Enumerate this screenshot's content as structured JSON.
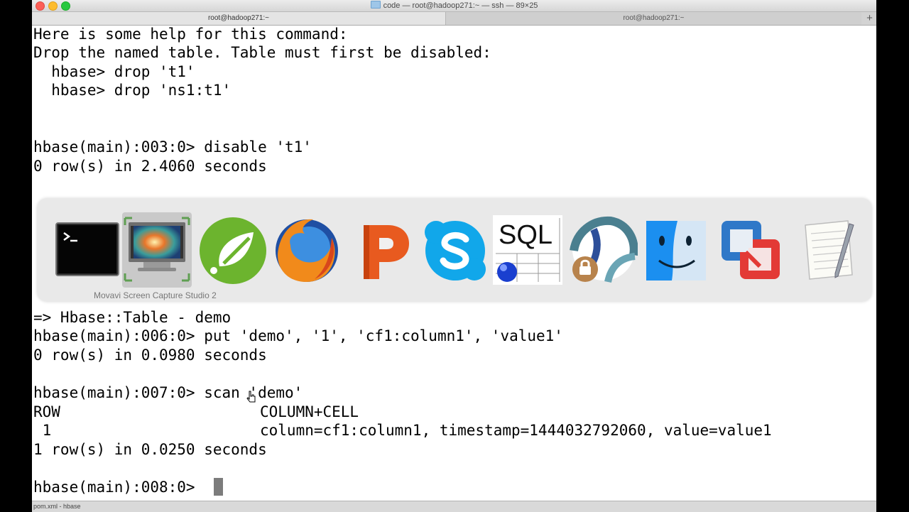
{
  "window": {
    "title": "code — root@hadoop271:~ — ssh — 89×25",
    "tabs": [
      {
        "label": "root@hadoop271:~"
      },
      {
        "label": "root@hadoop271:~"
      }
    ],
    "add_tab": "+"
  },
  "terminal": {
    "lines": [
      "Here is some help for this command:",
      "Drop the named table. Table must first be disabled:",
      "  hbase> drop 't1'",
      "  hbase> drop 'ns1:t1'",
      "hbase(main):003:0> disable 't1'",
      "0 row(s) in 2.4060 seconds",
      "=> Hbase::Table - demo",
      "hbase(main):006:0> put 'demo', '1', 'cf1:column1', 'value1'",
      "0 row(s) in 0.0980 seconds",
      "hbase(main):007:0> scan 'demo'",
      "1 row(s) in 0.0250 seconds",
      "hbase(main):008:0> "
    ],
    "scan_header": {
      "left": "ROW",
      "right": "COLUMN+CELL"
    },
    "scan_row": {
      "left": " 1",
      "right": "column=cf1:column1, timestamp=1444032792060, value=value1"
    }
  },
  "dock": {
    "tooltip": "Movavi Screen Capture Studio 2",
    "apps": [
      {
        "icon": "terminal-icon"
      },
      {
        "icon": "movavi-screen-capture-icon"
      },
      {
        "icon": "spring-icon"
      },
      {
        "icon": "firefox-icon"
      },
      {
        "icon": "wps-presentation-icon"
      },
      {
        "icon": "skype-icon"
      },
      {
        "icon": "sql-developer-icon",
        "label": "SQL"
      },
      {
        "icon": "vpn-client-icon"
      },
      {
        "icon": "finder-icon"
      },
      {
        "icon": "vmware-fusion-icon"
      },
      {
        "icon": "textedit-icon"
      }
    ]
  },
  "statusbar": {
    "text": "pom.xml - hbase"
  },
  "colors": {
    "terminal_bg": "#ffffff",
    "terminal_fg": "#000000",
    "cursor": "#7c7c7c"
  }
}
